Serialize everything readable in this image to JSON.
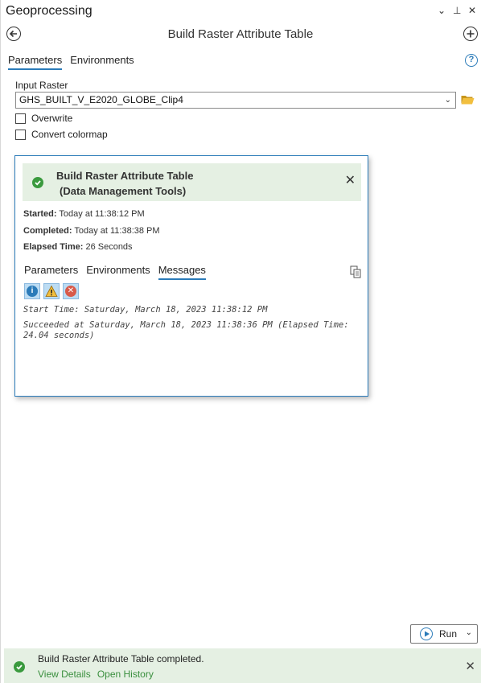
{
  "pane": {
    "title": "Geoprocessing",
    "controls": {
      "menu": "⌄",
      "pin": "⊥",
      "close": "✕"
    }
  },
  "tool": {
    "title": "Build Raster Attribute Table"
  },
  "tabs": {
    "parameters": "Parameters",
    "environments": "Environments",
    "help": "?"
  },
  "params": {
    "input_raster_label": "Input Raster",
    "input_raster_value": "GHS_BUILT_V_E2020_GLOBE_Clip4",
    "overwrite_label": "Overwrite",
    "convert_colormap_label": "Convert colormap"
  },
  "popup": {
    "title_line1": "Build Raster Attribute Table",
    "title_line2": "(Data Management Tools)",
    "started_label": "Started:",
    "started_value": "Today at 11:38:12 PM",
    "completed_label": "Completed:",
    "completed_value": "Today at 11:38:38 PM",
    "elapsed_label": "Elapsed Time:",
    "elapsed_value": "26 Seconds",
    "tabs": {
      "parameters": "Parameters",
      "environments": "Environments",
      "messages": "Messages"
    },
    "messages": [
      "Start Time: Saturday, March 18, 2023 11:38:12 PM",
      "Succeeded at Saturday, March 18, 2023 11:38:36 PM (Elapsed Time: 24.04 seconds)"
    ],
    "filter_icons": [
      "info-icon",
      "warning-icon",
      "error-icon"
    ]
  },
  "run": {
    "label": "Run"
  },
  "status": {
    "message": "Build Raster Attribute Table completed.",
    "view_details": "View Details",
    "open_history": "Open History"
  },
  "colors": {
    "accent": "#2b7bb9",
    "success_bg": "#e5f0e3",
    "success_icon": "#3a9a3e",
    "link": "#3a8f3e"
  }
}
